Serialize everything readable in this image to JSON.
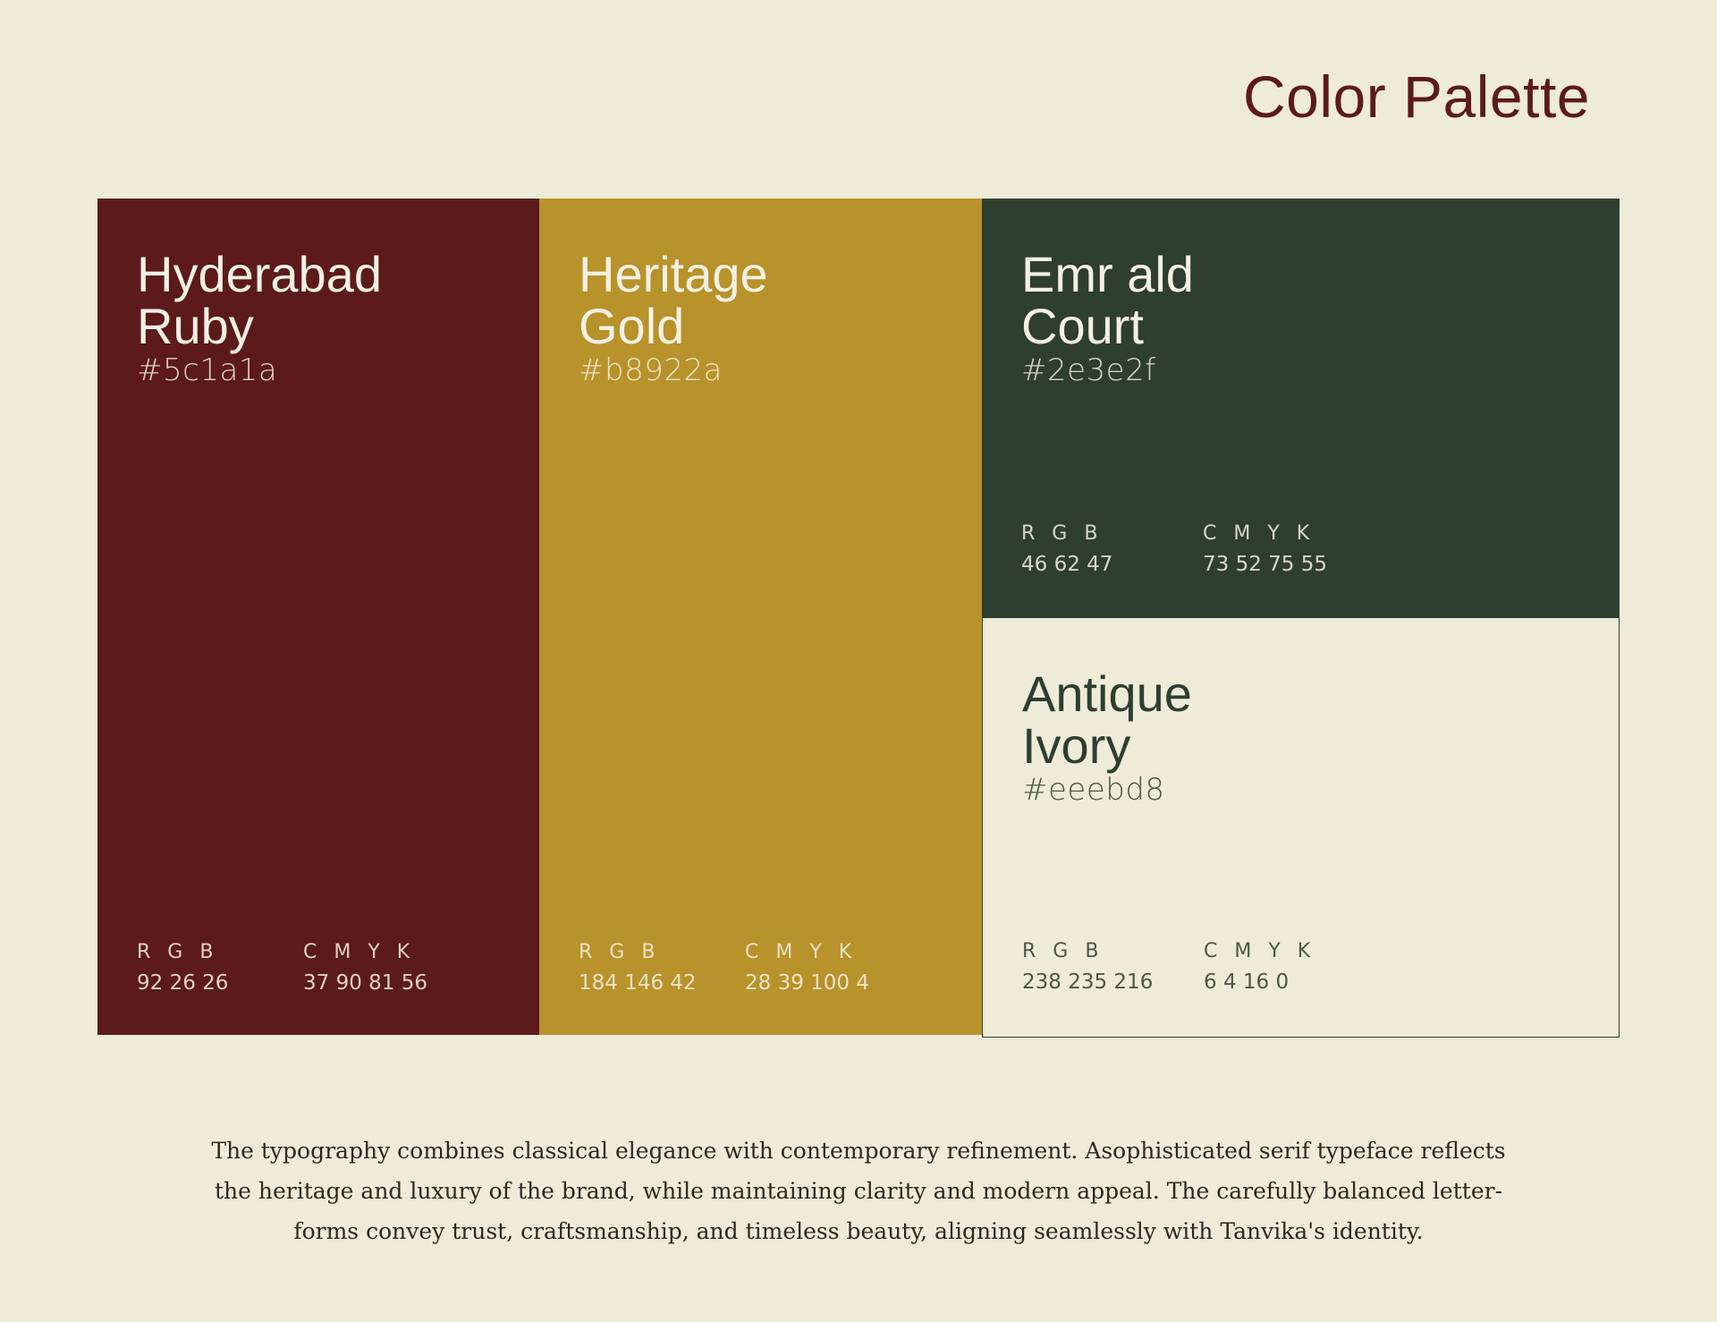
{
  "page": {
    "title": "Color Palette",
    "background": "#eeebd8",
    "title_color": "#5c1a1a"
  },
  "swatches": [
    {
      "name_line1": "Hyderabad",
      "name_line2": "Ruby",
      "hex": "#5c1a1a",
      "rgb_label": "R G B",
      "rgb": "92 26 26",
      "cmyk_label": "C M Y K",
      "cmyk": "37 90 81 56",
      "color": "#5c1a1a",
      "text_color": "#f4f1e4"
    },
    {
      "name_line1": "Heritage",
      "name_line2": "Gold",
      "hex": "#b8922a",
      "rgb_label": "R G B",
      "rgb": "184 146 42",
      "cmyk_label": "C M Y K",
      "cmyk": "28 39 100 4",
      "color": "#b8922a",
      "text_color": "#f4f1e4"
    },
    {
      "name_line1": "Emr ald",
      "name_line2": "Court",
      "hex": "#2e3e2f",
      "rgb_label": "R G B",
      "rgb": "46 62 47",
      "cmyk_label": "C M Y K",
      "cmyk": "73 52 75 55",
      "color": "#2e3e2f",
      "text_color": "#f4f1e4"
    },
    {
      "name_line1": "Antique",
      "name_line2": "Ivory",
      "hex": "#eeebd8",
      "rgb_label": "R G B",
      "rgb": "238 235 216",
      "cmyk_label": "C M Y K",
      "cmyk": "6 4 16 0",
      "color": "#eeebd8",
      "text_color": "#2e3e2f"
    }
  ],
  "description": {
    "line1": "The typography combines classical elegance with contemporary refinement. Asophisticated serif typeface reflects",
    "line2": "the heritage and luxury of the brand, while maintaining clarity and modern appeal. The carefully balanced letter-",
    "line3": "forms convey trust, craftsmanship, and timeless beauty, aligning seamlessly with Tanvika's identity."
  }
}
